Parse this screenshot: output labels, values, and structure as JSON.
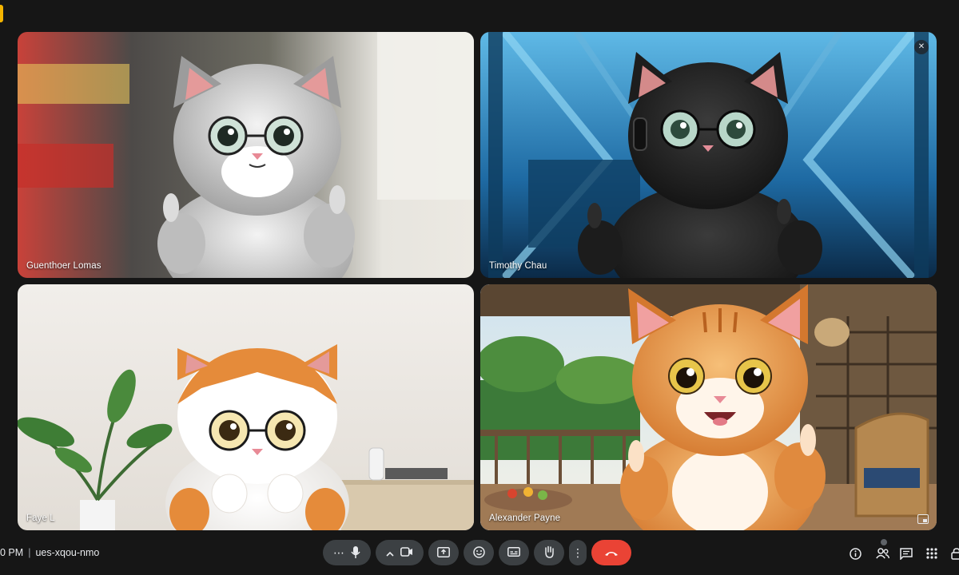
{
  "participants": [
    {
      "name": "Guenthoer Lomas"
    },
    {
      "name": "Timothy Chau"
    },
    {
      "name": "Faye L"
    },
    {
      "name": "Alexander Payne"
    }
  ],
  "meeting": {
    "time": "0 PM",
    "separator": "|",
    "code": "ues-xqou-nmo"
  },
  "controls": {
    "more_left": "⋯",
    "mic_icon": "mic-icon",
    "camera_icon": "camera-icon",
    "present_icon": "present-icon",
    "emoji_icon": "emoji-icon",
    "captions_icon": "captions-icon",
    "hand_icon": "raise-hand-icon",
    "more_options": "⋮",
    "end_call_icon": "end-call-icon"
  },
  "right_panel": {
    "info_icon": "info-icon",
    "people_icon": "people-icon",
    "chat_icon": "chat-icon",
    "activities_icon": "activities-icon",
    "host_icon": "host-controls-icon"
  },
  "colors": {
    "background": "#161616",
    "control_bg": "#3c4043",
    "end_call": "#ea4335",
    "active_border": "#8ab4f8",
    "accent_tab": "#f4b400"
  }
}
